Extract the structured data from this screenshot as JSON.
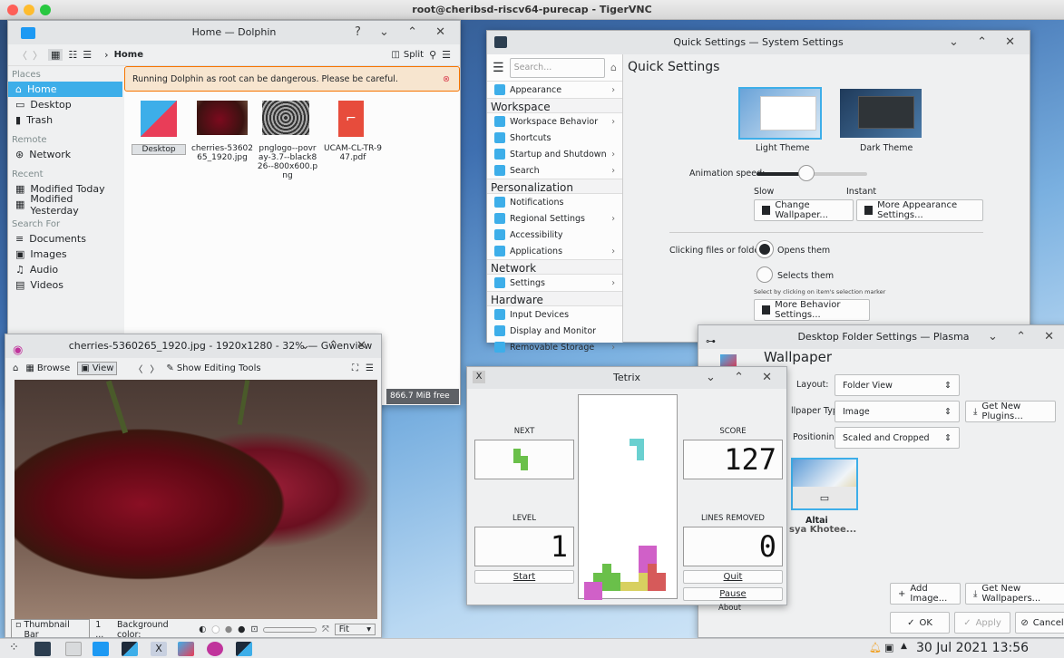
{
  "vnc": {
    "title": "root@cheribsd-riscv64-purecap - TigerVNC"
  },
  "dolphin": {
    "title": "Home — Dolphin",
    "breadcrumb": "Home",
    "split_label": "Split",
    "warning": "Running Dolphin as root can be dangerous. Please be careful.",
    "free_space": "866.7 MiB free",
    "sidebar": {
      "places_header": "Places",
      "places": [
        "Home",
        "Desktop",
        "Trash"
      ],
      "remote_header": "Remote",
      "remote": [
        "Network"
      ],
      "recent_header": "Recent",
      "recent": [
        "Modified Today",
        "Modified Yesterday"
      ],
      "search_header": "Search For",
      "search": [
        "Documents",
        "Images",
        "Audio",
        "Videos"
      ]
    },
    "files": [
      {
        "name": "Desktop",
        "icon": "folder-icon"
      },
      {
        "name": "cherries-5360265_1920.jpg",
        "icon": "image-icon"
      },
      {
        "name": "pnglogo--povray-3.7--black826--800x600.png",
        "icon": "image-icon"
      },
      {
        "name": "UCAM-CL-TR-947.pdf",
        "icon": "pdf-icon"
      }
    ]
  },
  "settings": {
    "title": "Quick Settings — System Settings",
    "heading": "Quick Settings",
    "search_placeholder": "Search...",
    "categories": [
      {
        "label": "Appearance",
        "arrow": true
      },
      {
        "section": "Workspace"
      },
      {
        "label": "Workspace Behavior",
        "arrow": true
      },
      {
        "label": "Shortcuts",
        "arrow": false
      },
      {
        "label": "Startup and Shutdown",
        "arrow": true
      },
      {
        "label": "Search",
        "arrow": true
      },
      {
        "section": "Personalization"
      },
      {
        "label": "Notifications",
        "arrow": false
      },
      {
        "label": "Regional Settings",
        "arrow": true
      },
      {
        "label": "Accessibility",
        "arrow": false
      },
      {
        "label": "Applications",
        "arrow": true
      },
      {
        "section": "Network"
      },
      {
        "label": "Settings",
        "arrow": true
      },
      {
        "section": "Hardware"
      },
      {
        "label": "Input Devices",
        "arrow": false
      },
      {
        "label": "Display and Monitor",
        "arrow": false
      },
      {
        "label": "Removable Storage",
        "arrow": true
      }
    ],
    "light_theme": "Light Theme",
    "dark_theme": "Dark Theme",
    "animation_label": "Animation speed:",
    "animation_value": 0.45,
    "slow": "Slow",
    "instant": "Instant",
    "change_wallpaper": "Change Wallpaper...",
    "more_appearance": "More Appearance Settings...",
    "clicking_label": "Clicking files or folders:",
    "opens": "Opens them",
    "selects": "Selects them",
    "hint": "Select by clicking on item's selection marker",
    "more_behavior": "More Behavior Settings..."
  },
  "folder_settings": {
    "title": "Desktop Folder Settings — Plasma",
    "heading": "Wallpaper",
    "layout_label": "Layout:",
    "layout_value": "Folder View",
    "type_label": "llpaper Type:",
    "type_value": "Image",
    "get_plugins": "Get New Plugins...",
    "positioning_label": "Positioning:",
    "positioning_value": "Scaled and Cropped",
    "wallpaper_name": "Altai",
    "wallpaper_author": "sya Khotee...",
    "add_image": "Add Image...",
    "get_wallpapers": "Get New Wallpapers...",
    "ok": "OK",
    "apply": "Apply",
    "cancel": "Cancel"
  },
  "gwenview": {
    "title": "cherries-5360265_1920.jpg - 1920x1280 - 32% — Gwenview",
    "browse": "Browse",
    "view": "View",
    "editing": "Show Editing Tools",
    "thumbnail_bar": "Thumbnail Bar",
    "page": "1 ...",
    "background_color": "Background color:",
    "zoom": "Fit"
  },
  "tetrix": {
    "title": "Tetrix",
    "next": "NEXT",
    "score_label": "SCORE",
    "score": "127",
    "level_label": "LEVEL",
    "level": "1",
    "lines_label": "LINES REMOVED",
    "lines": "0",
    "start": "Start",
    "quit": "Quit",
    "pause": "Pause",
    "about": "About"
  },
  "taskbar": {
    "clock": "30 Jul 2021 13:56"
  },
  "colors": {
    "accent": "#3daee9",
    "warning_bg": "#f7e5cf",
    "warning_border": "#f67400"
  }
}
